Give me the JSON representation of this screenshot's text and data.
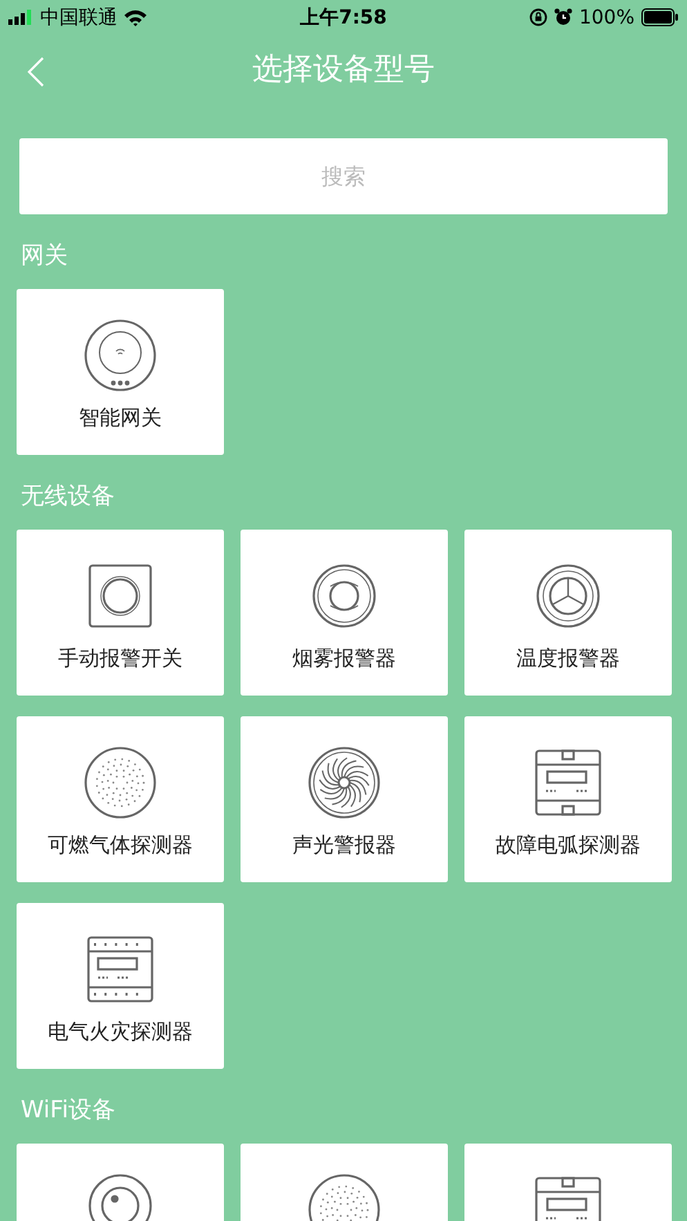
{
  "status_bar": {
    "carrier": "中国联通",
    "time": "上午7:58",
    "battery": "100%"
  },
  "nav": {
    "title": "选择设备型号"
  },
  "search": {
    "placeholder": "搜索"
  },
  "sections": [
    {
      "title": "网关",
      "items": [
        {
          "kind": "gateway",
          "label": "智能网关"
        }
      ]
    },
    {
      "title": "无线设备",
      "items": [
        {
          "kind": "switch",
          "label": "手动报警开关"
        },
        {
          "kind": "smoke",
          "label": "烟雾报警器"
        },
        {
          "kind": "temperature",
          "label": "温度报警器"
        },
        {
          "kind": "gas",
          "label": "可燃气体探测器"
        },
        {
          "kind": "siren",
          "label": "声光警报器"
        },
        {
          "kind": "meter",
          "label": "故障电弧探测器"
        },
        {
          "kind": "meter-dots",
          "label": "电气火灾探测器"
        }
      ]
    },
    {
      "title": "WiFi设备",
      "items": [
        {
          "kind": "camera"
        },
        {
          "kind": "gas"
        },
        {
          "kind": "meter"
        }
      ]
    }
  ]
}
